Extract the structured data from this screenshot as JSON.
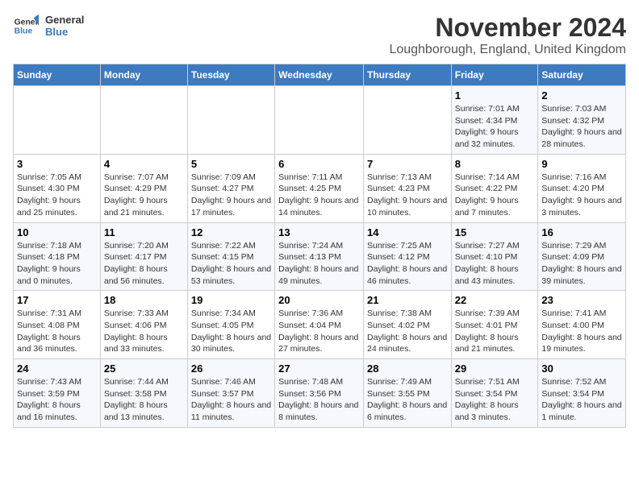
{
  "header": {
    "logo_line1": "General",
    "logo_line2": "Blue",
    "month_title": "November 2024",
    "location": "Loughborough, England, United Kingdom"
  },
  "weekdays": [
    "Sunday",
    "Monday",
    "Tuesday",
    "Wednesday",
    "Thursday",
    "Friday",
    "Saturday"
  ],
  "weeks": [
    [
      {
        "day": "",
        "info": ""
      },
      {
        "day": "",
        "info": ""
      },
      {
        "day": "",
        "info": ""
      },
      {
        "day": "",
        "info": ""
      },
      {
        "day": "",
        "info": ""
      },
      {
        "day": "1",
        "info": "Sunrise: 7:01 AM\nSunset: 4:34 PM\nDaylight: 9 hours and 32 minutes."
      },
      {
        "day": "2",
        "info": "Sunrise: 7:03 AM\nSunset: 4:32 PM\nDaylight: 9 hours and 28 minutes."
      }
    ],
    [
      {
        "day": "3",
        "info": "Sunrise: 7:05 AM\nSunset: 4:30 PM\nDaylight: 9 hours and 25 minutes."
      },
      {
        "day": "4",
        "info": "Sunrise: 7:07 AM\nSunset: 4:29 PM\nDaylight: 9 hours and 21 minutes."
      },
      {
        "day": "5",
        "info": "Sunrise: 7:09 AM\nSunset: 4:27 PM\nDaylight: 9 hours and 17 minutes."
      },
      {
        "day": "6",
        "info": "Sunrise: 7:11 AM\nSunset: 4:25 PM\nDaylight: 9 hours and 14 minutes."
      },
      {
        "day": "7",
        "info": "Sunrise: 7:13 AM\nSunset: 4:23 PM\nDaylight: 9 hours and 10 minutes."
      },
      {
        "day": "8",
        "info": "Sunrise: 7:14 AM\nSunset: 4:22 PM\nDaylight: 9 hours and 7 minutes."
      },
      {
        "day": "9",
        "info": "Sunrise: 7:16 AM\nSunset: 4:20 PM\nDaylight: 9 hours and 3 minutes."
      }
    ],
    [
      {
        "day": "10",
        "info": "Sunrise: 7:18 AM\nSunset: 4:18 PM\nDaylight: 9 hours and 0 minutes."
      },
      {
        "day": "11",
        "info": "Sunrise: 7:20 AM\nSunset: 4:17 PM\nDaylight: 8 hours and 56 minutes."
      },
      {
        "day": "12",
        "info": "Sunrise: 7:22 AM\nSunset: 4:15 PM\nDaylight: 8 hours and 53 minutes."
      },
      {
        "day": "13",
        "info": "Sunrise: 7:24 AM\nSunset: 4:13 PM\nDaylight: 8 hours and 49 minutes."
      },
      {
        "day": "14",
        "info": "Sunrise: 7:25 AM\nSunset: 4:12 PM\nDaylight: 8 hours and 46 minutes."
      },
      {
        "day": "15",
        "info": "Sunrise: 7:27 AM\nSunset: 4:10 PM\nDaylight: 8 hours and 43 minutes."
      },
      {
        "day": "16",
        "info": "Sunrise: 7:29 AM\nSunset: 4:09 PM\nDaylight: 8 hours and 39 minutes."
      }
    ],
    [
      {
        "day": "17",
        "info": "Sunrise: 7:31 AM\nSunset: 4:08 PM\nDaylight: 8 hours and 36 minutes."
      },
      {
        "day": "18",
        "info": "Sunrise: 7:33 AM\nSunset: 4:06 PM\nDaylight: 8 hours and 33 minutes."
      },
      {
        "day": "19",
        "info": "Sunrise: 7:34 AM\nSunset: 4:05 PM\nDaylight: 8 hours and 30 minutes."
      },
      {
        "day": "20",
        "info": "Sunrise: 7:36 AM\nSunset: 4:04 PM\nDaylight: 8 hours and 27 minutes."
      },
      {
        "day": "21",
        "info": "Sunrise: 7:38 AM\nSunset: 4:02 PM\nDaylight: 8 hours and 24 minutes."
      },
      {
        "day": "22",
        "info": "Sunrise: 7:39 AM\nSunset: 4:01 PM\nDaylight: 8 hours and 21 minutes."
      },
      {
        "day": "23",
        "info": "Sunrise: 7:41 AM\nSunset: 4:00 PM\nDaylight: 8 hours and 19 minutes."
      }
    ],
    [
      {
        "day": "24",
        "info": "Sunrise: 7:43 AM\nSunset: 3:59 PM\nDaylight: 8 hours and 16 minutes."
      },
      {
        "day": "25",
        "info": "Sunrise: 7:44 AM\nSunset: 3:58 PM\nDaylight: 8 hours and 13 minutes."
      },
      {
        "day": "26",
        "info": "Sunrise: 7:46 AM\nSunset: 3:57 PM\nDaylight: 8 hours and 11 minutes."
      },
      {
        "day": "27",
        "info": "Sunrise: 7:48 AM\nSunset: 3:56 PM\nDaylight: 8 hours and 8 minutes."
      },
      {
        "day": "28",
        "info": "Sunrise: 7:49 AM\nSunset: 3:55 PM\nDaylight: 8 hours and 6 minutes."
      },
      {
        "day": "29",
        "info": "Sunrise: 7:51 AM\nSunset: 3:54 PM\nDaylight: 8 hours and 3 minutes."
      },
      {
        "day": "30",
        "info": "Sunrise: 7:52 AM\nSunset: 3:54 PM\nDaylight: 8 hours and 1 minute."
      }
    ]
  ]
}
